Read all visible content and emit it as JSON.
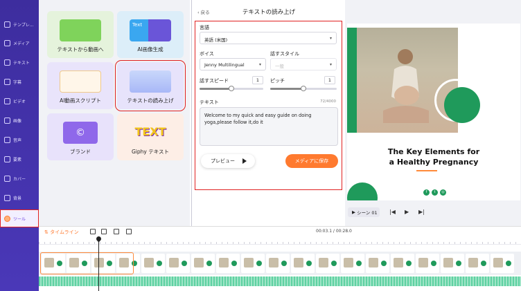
{
  "sidebar": {
    "items": [
      {
        "label": "テンプレ..."
      },
      {
        "label": "メディア"
      },
      {
        "label": "テキスト"
      },
      {
        "label": "字幕"
      },
      {
        "label": "ビデオ"
      },
      {
        "label": "画像"
      },
      {
        "label": "音声"
      },
      {
        "label": "要素"
      },
      {
        "label": "カバー"
      },
      {
        "label": "背景"
      },
      {
        "label": "ツール"
      }
    ]
  },
  "tools": {
    "cards": [
      {
        "label": "テキストから動画へ"
      },
      {
        "label": "AI画像生成",
        "thumb_text": "Text"
      },
      {
        "label": "AI動画スクリプト"
      },
      {
        "label": "テキストの読み上げ"
      },
      {
        "label": "ブランド"
      },
      {
        "label": "Giphy テキスト",
        "thumb_text": "TEXT"
      }
    ]
  },
  "panel": {
    "back_label": "戻る",
    "title": "テキストの読み上げ",
    "language_label": "言語",
    "language_value": "英語 (米国)",
    "voice_label": "ボイス",
    "voice_value": "Jenny Multilingual",
    "style_label": "話すスタイル",
    "style_value": "一般",
    "speed_label": "話すスピード",
    "speed_value": "1",
    "speed_fraction": 0.5,
    "pitch_label": "ピッチ",
    "pitch_value": "1",
    "pitch_fraction": 0.5,
    "text_label": "テキスト",
    "text_counter": "72/4000",
    "text_value": "Welcome to my quick and  easy guide on doing yoga,please follow it,do it",
    "preview_label": "プレビュー",
    "save_label": "メディアに保存"
  },
  "canvas": {
    "headline_line1": "The Key Elements for",
    "headline_line2": "a Healthy Pregnancy",
    "social_icons": [
      "facebook-icon",
      "twitter-icon",
      "instagram-icon"
    ],
    "accent_color": "#1f9a5b"
  },
  "scene": {
    "label": "シーン 01"
  },
  "timeline": {
    "label": "タイムライン",
    "time": "00:03.1 / 00:28.0"
  }
}
